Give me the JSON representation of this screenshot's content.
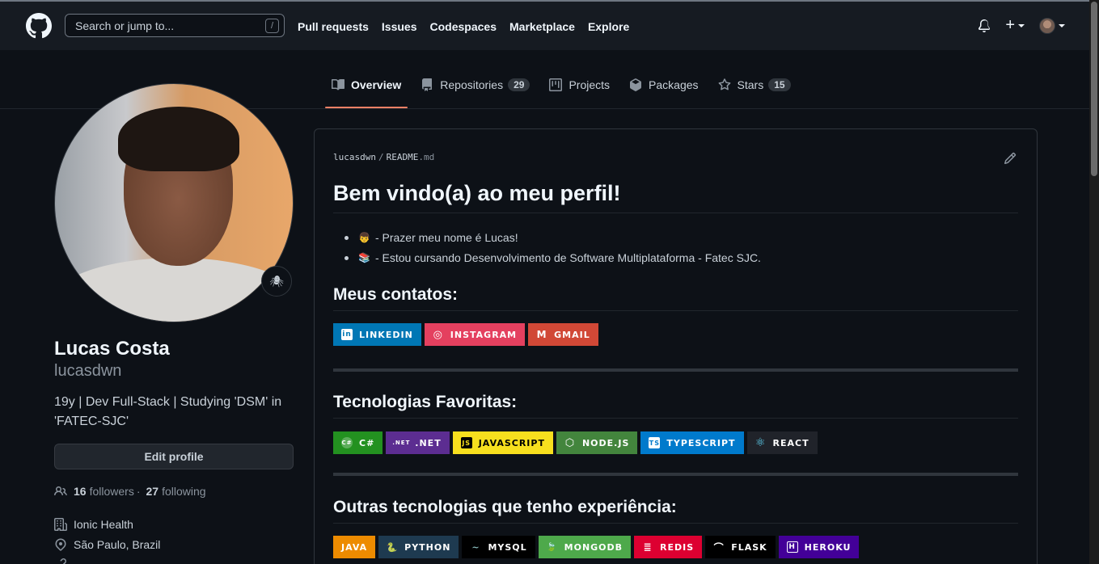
{
  "header": {
    "search_placeholder": "Search or jump to...",
    "search_shortcut": "/",
    "nav": [
      "Pull requests",
      "Issues",
      "Codespaces",
      "Marketplace",
      "Explore"
    ],
    "plus_label": "+"
  },
  "tabs": [
    {
      "label": "Overview",
      "icon": "book-icon",
      "active": true
    },
    {
      "label": "Repositories",
      "icon": "repo-icon",
      "count": "29"
    },
    {
      "label": "Projects",
      "icon": "project-icon"
    },
    {
      "label": "Packages",
      "icon": "package-icon"
    },
    {
      "label": "Stars",
      "icon": "star-icon",
      "count": "15"
    }
  ],
  "profile": {
    "name": "Lucas Costa",
    "login": "lucasdwn",
    "bio": "19y | Dev Full-Stack | Studying 'DSM' in 'FATEC-SJC'",
    "edit_label": "Edit profile",
    "followers": "16",
    "followers_label": "followers",
    "following": "27",
    "following_label": "following",
    "company": "Ionic Health",
    "location": "São Paulo, Brazil",
    "emoji_status": "🕷"
  },
  "readme": {
    "owner": "lucasdwn",
    "file": "README",
    "ext": ".md",
    "title": "Bem vindo(a) ao meu perfil!",
    "bullets": [
      {
        "emoji": "👦",
        "text": "- Prazer meu nome é Lucas!"
      },
      {
        "emoji": "📚",
        "text": "- Estou cursando Desenvolvimento de Software Multiplataforma - Fatec SJC."
      }
    ],
    "contacts_title": "Meus contatos:",
    "contacts": [
      {
        "label": "LINKEDIN",
        "color": "#0077b5",
        "icon": "in"
      },
      {
        "label": "INSTAGRAM",
        "color": "#e4405f",
        "icon": "◎"
      },
      {
        "label": "GMAIL",
        "color": "#d14836",
        "icon": "M"
      }
    ],
    "fav_title": "Tecnologias Favoritas:",
    "fav": [
      {
        "label": "C#",
        "color": "#239120",
        "icon": "C#",
        "icon_bg": "#ffffff33"
      },
      {
        "label": ".NET",
        "color": "#5c2d91",
        "icon": ".NET"
      },
      {
        "label": "JAVASCRIPT",
        "color": "#f7df1e",
        "icon": "JS",
        "dark": true
      },
      {
        "label": "NODE.JS",
        "color": "#43853d",
        "icon": "⬡"
      },
      {
        "label": "TYPESCRIPT",
        "color": "#007acc",
        "icon": "TS"
      },
      {
        "label": "REACT",
        "color": "#20232a",
        "icon": "⚛"
      }
    ],
    "other_title": "Outras tecnologias que tenho experiência:",
    "other": [
      {
        "label": "JAVA",
        "color": "#ed8b00",
        "icon": ""
      },
      {
        "label": "PYTHON",
        "color": "#3670a0",
        "icon": "🐍"
      },
      {
        "label": "MYSQL",
        "color": "#000000",
        "icon": "~"
      },
      {
        "label": "MONGODB",
        "color": "#4ea94b",
        "icon": "🍃"
      },
      {
        "label": "REDIS",
        "color": "#dd0031",
        "icon": "≣"
      },
      {
        "label": "FLASK",
        "color": "#000000",
        "icon": "⌒"
      },
      {
        "label": "HEROKU",
        "color": "#430098",
        "icon": "H"
      }
    ]
  }
}
